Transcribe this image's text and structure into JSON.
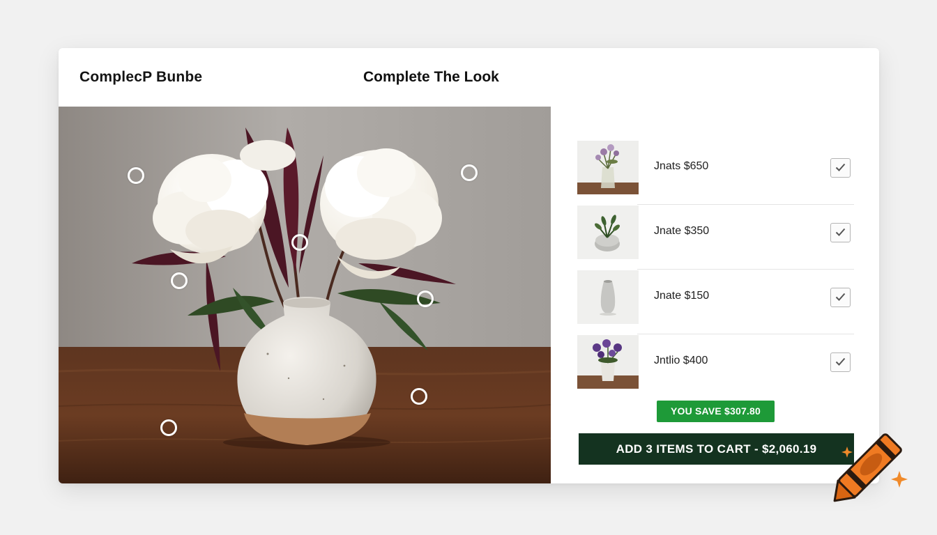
{
  "header": {
    "brand": "ComplecP Bunbe",
    "title": "Complete The Look"
  },
  "items": [
    {
      "label": "Jnats $650",
      "checked": true,
      "thumb_icon": "flower-glass-vase-icon"
    },
    {
      "label": "Jnate $350",
      "checked": true,
      "thumb_icon": "stone-planter-icon"
    },
    {
      "label": "Jnate $150",
      "checked": true,
      "thumb_icon": "tall-vase-icon"
    },
    {
      "label": "Jntlio $400",
      "checked": true,
      "thumb_icon": "purple-flowers-pot-icon"
    }
  ],
  "savings": {
    "label": "YOU SAVE $307.80"
  },
  "cart": {
    "label": "ADD 3 ITEMS TO CART - $2,060.19"
  },
  "colors": {
    "save_badge": "#1e9a38",
    "cart_button": "#143320",
    "card_background": "#ffffff",
    "page_background": "#f1f1f1",
    "crayon": "#ef7a22"
  },
  "decor": {
    "corner_icon": "crayon-icon",
    "sparkle_icon": "sparkle-icon"
  }
}
